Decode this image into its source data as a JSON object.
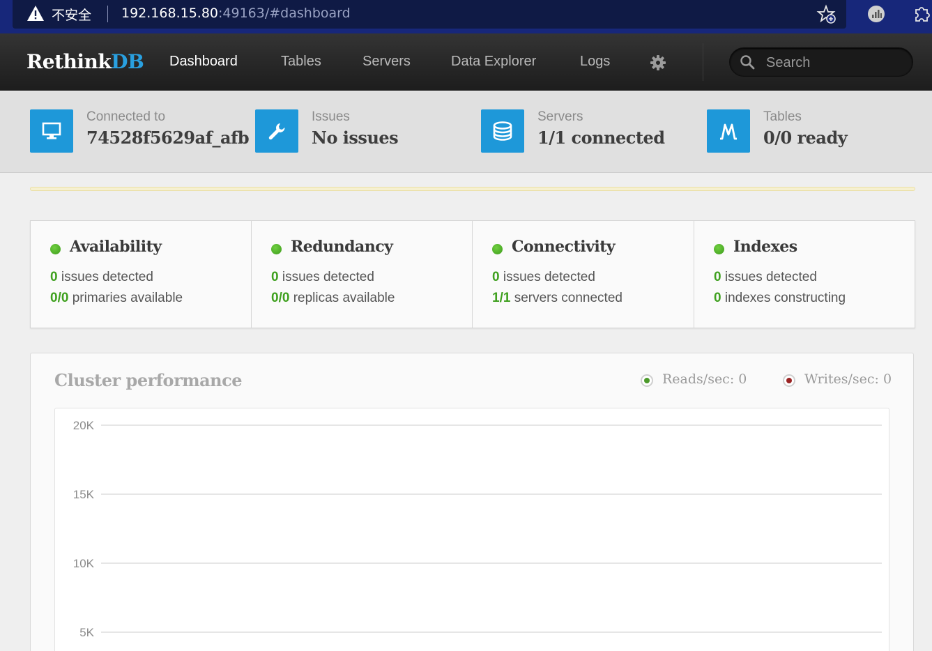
{
  "browser": {
    "insecure_label": "不安全",
    "url_host": "192.168.15.80",
    "url_rest": ":49163/#dashboard",
    "icons": [
      "warning-icon",
      "favorite-add-icon",
      "extension-icon",
      "puzzle-icon"
    ]
  },
  "nav": {
    "brand_prefix": "Rethink",
    "brand_suffix": "DB",
    "items": [
      {
        "label": "Dashboard",
        "active": true
      },
      {
        "label": "Tables",
        "active": false
      },
      {
        "label": "Servers",
        "active": false
      },
      {
        "label": "Data Explorer",
        "active": false
      },
      {
        "label": "Logs",
        "active": false
      }
    ],
    "search_placeholder": "Search"
  },
  "status": [
    {
      "label": "Connected to",
      "value": "74528f5629af_afb",
      "icon": "monitor-icon"
    },
    {
      "label": "Issues",
      "value": "No issues",
      "icon": "wrench-icon"
    },
    {
      "label": "Servers",
      "value": "1/1 connected",
      "icon": "database-icon"
    },
    {
      "label": "Tables",
      "value": "0/0 ready",
      "icon": "tables-icon"
    }
  ],
  "health": [
    {
      "title": "Availability",
      "line1_num": "0",
      "line1_text": " issues detected",
      "line2_num": "0/0",
      "line2_text": " primaries available"
    },
    {
      "title": "Redundancy",
      "line1_num": "0",
      "line1_text": " issues detected",
      "line2_num": "0/0",
      "line2_text": " replicas available"
    },
    {
      "title": "Connectivity",
      "line1_num": "0",
      "line1_text": " issues detected",
      "line2_num": "1/1",
      "line2_text": " servers connected"
    },
    {
      "title": "Indexes",
      "line1_num": "0",
      "line1_text": " issues detected",
      "line2_num": "0",
      "line2_text": " indexes constructing"
    }
  ],
  "colors": {
    "accent": "#1e98d9",
    "ok_green": "#3fa01f",
    "reads": "#4c9a2a",
    "writes": "#9a2323"
  },
  "chart_data": {
    "type": "line",
    "title": "Cluster performance",
    "series": [
      {
        "name": "Reads/sec",
        "legend": "Reads/sec: 0",
        "values": [
          0
        ]
      },
      {
        "name": "Writes/sec",
        "legend": "Writes/sec: 0",
        "values": [
          0
        ]
      }
    ],
    "y_ticks": [
      {
        "value": 20000,
        "label": "20K"
      },
      {
        "value": 15000,
        "label": "15K"
      },
      {
        "value": 10000,
        "label": "10K"
      },
      {
        "value": 5000,
        "label": "5K"
      }
    ],
    "ylim": [
      0,
      20000
    ],
    "grid": true,
    "legend": "top-right"
  }
}
